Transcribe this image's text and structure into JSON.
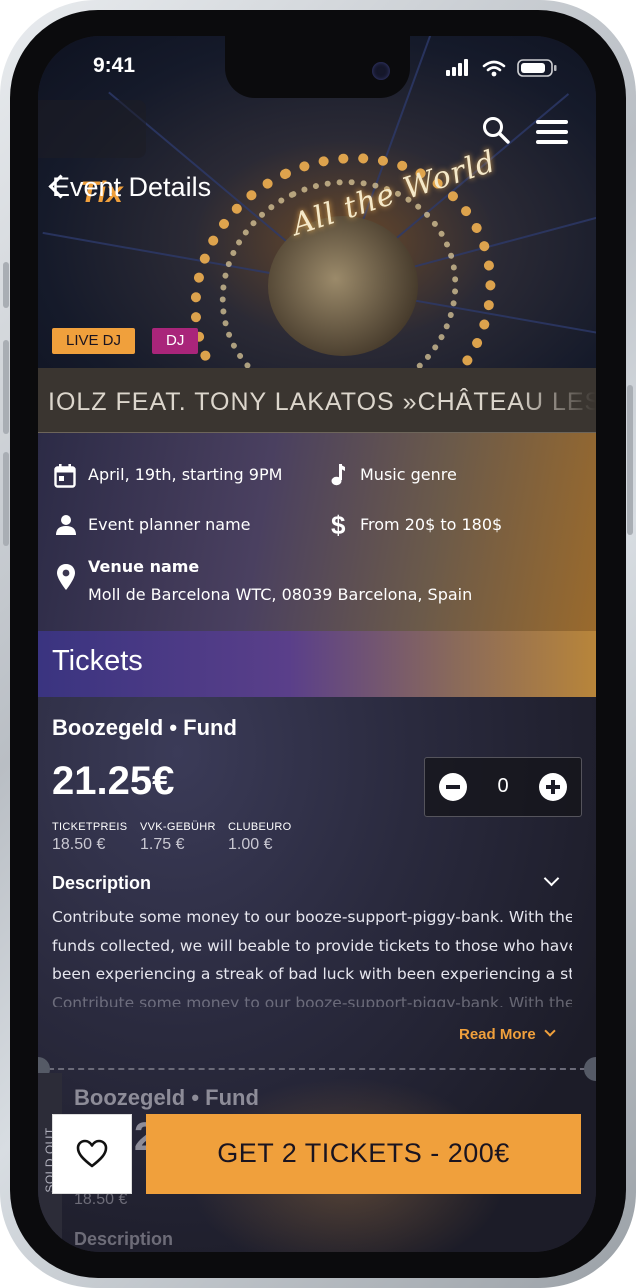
{
  "status_bar": {
    "time": "9:41"
  },
  "header": {
    "logo": "Tix",
    "page_title": "Event Details",
    "hero_sign": "All the World"
  },
  "tags": [
    {
      "label": "LIVE DJ",
      "color": "#f0a03c"
    },
    {
      "label": "DJ",
      "color": "#a9257a"
    }
  ],
  "event": {
    "marquee_title": "IOLZ FEAT. TONY LAKATOS »CHÂTEAU LES C",
    "date": "April, 19th, starting 9PM",
    "genre": "Music genre",
    "planner": "Event planner name",
    "price_range": "From 20$ to 180$",
    "venue_name": "Venue name",
    "venue_address": "Moll de Barcelona WTC, 08039 Barcelona, Spain"
  },
  "tickets": {
    "section_title": "Tickets",
    "items": [
      {
        "title": "Boozegeld • Fund",
        "price": "21.25€",
        "quantity": "0",
        "fees": [
          {
            "label": "TICKETPREIS",
            "value": "18.50 €"
          },
          {
            "label": "VVK-GEBÜHR",
            "value": "1.75 €"
          },
          {
            "label": "CLUBEURO",
            "value": "1.00 €"
          }
        ],
        "description_title": "Description",
        "description_lines": [
          "Contribute some money to our booze-support-piggy-bank. With the",
          "funds collected, we will beable to provide tickets to those who have",
          "been experiencing a streak of bad luck with been experiencing a stre",
          "Contribute some money to our booze-support-piggy-bank. With the f"
        ],
        "read_more": "Read More"
      },
      {
        "title": "Boozegeld • Fund",
        "price_partial": "2",
        "fee_partial": "18.50 €",
        "badge": "SOLD OUT",
        "description_title": "Description"
      }
    ]
  },
  "cta": {
    "label": "GET 2 TICKETS - 200€"
  },
  "colors": {
    "accent": "#f0a03c",
    "dj_tag": "#a9257a",
    "background": "#1b1a28"
  }
}
